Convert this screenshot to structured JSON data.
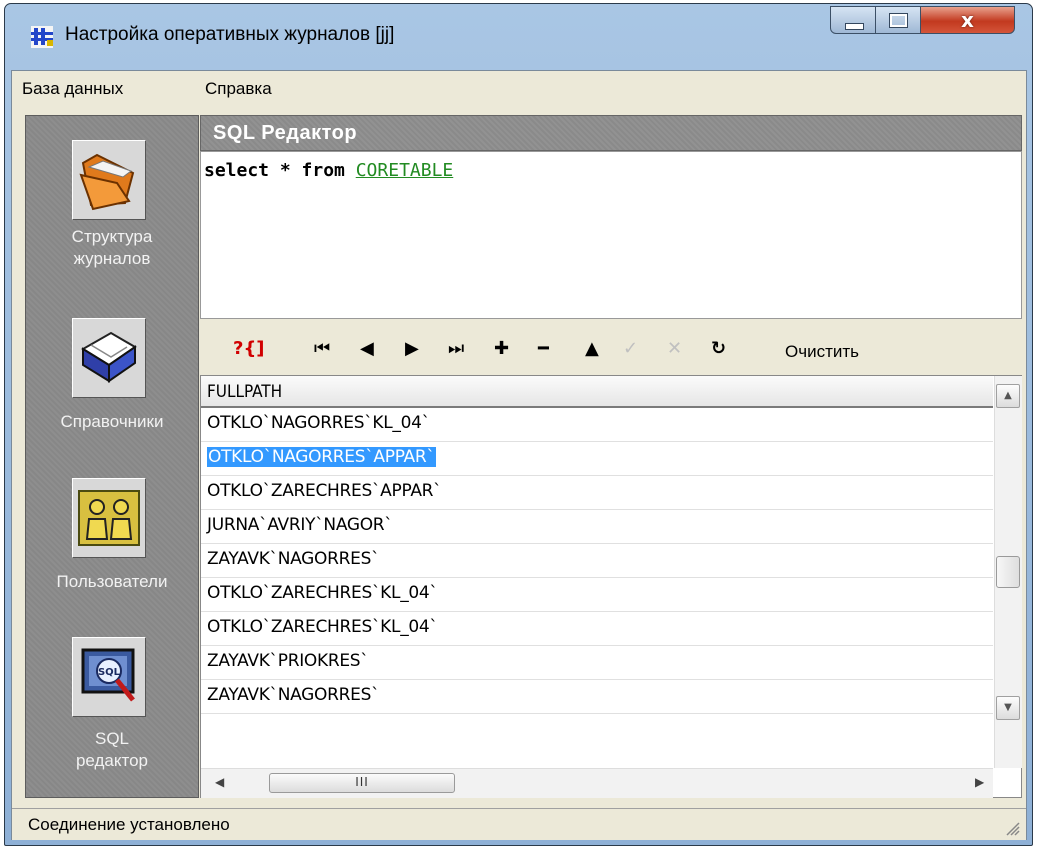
{
  "window": {
    "title": "Настройка оперативных журналов [jj]",
    "close_label": "x"
  },
  "menu": [
    "База данных",
    "Справка"
  ],
  "sidebar": {
    "items": [
      {
        "label_line1": "Структура",
        "label_line2": "журналов",
        "icon": "folder-icon"
      },
      {
        "label_line1": "Справочники",
        "label_line2": "",
        "icon": "book-icon"
      },
      {
        "label_line1": "Пользователи",
        "label_line2": "",
        "icon": "users-icon"
      },
      {
        "label_line1": "SQL",
        "label_line2": "редактор",
        "icon": "sql-icon"
      }
    ]
  },
  "sql_panel": {
    "title": "SQL Редактор",
    "query_prefix": "select * from ",
    "query_table": "CORETABLE"
  },
  "toolbar": {
    "help_symbol": "?{]",
    "first": "⏮",
    "prev": "◀",
    "next": "▶",
    "last": "⏭",
    "insert": "✚",
    "delete": "━",
    "edit": "▲",
    "post": "✓",
    "cancel": "✕",
    "refresh": "↻",
    "clear_label": "Очистить"
  },
  "grid": {
    "columns": [
      "FULLPATH"
    ],
    "rows": [
      "OTKLO`NAGORRES`KL_04`",
      "OTKLO`NAGORRES`APPAR`",
      "OTKLO`ZARECHRES`APPAR`",
      "JURNA`AVRIY`NAGOR`",
      "ZAYAVK`NAGORRES`",
      "OTKLO`ZARECHRES`KL_04`",
      "OTKLO`ZARECHRES`KL_04`",
      "ZAYAVK`PRIOKRES`",
      "ZAYAVK`NAGORRES`"
    ],
    "selected_row": 1,
    "hscroll_thumb": "III"
  },
  "status": {
    "text": "Соединение установлено"
  }
}
